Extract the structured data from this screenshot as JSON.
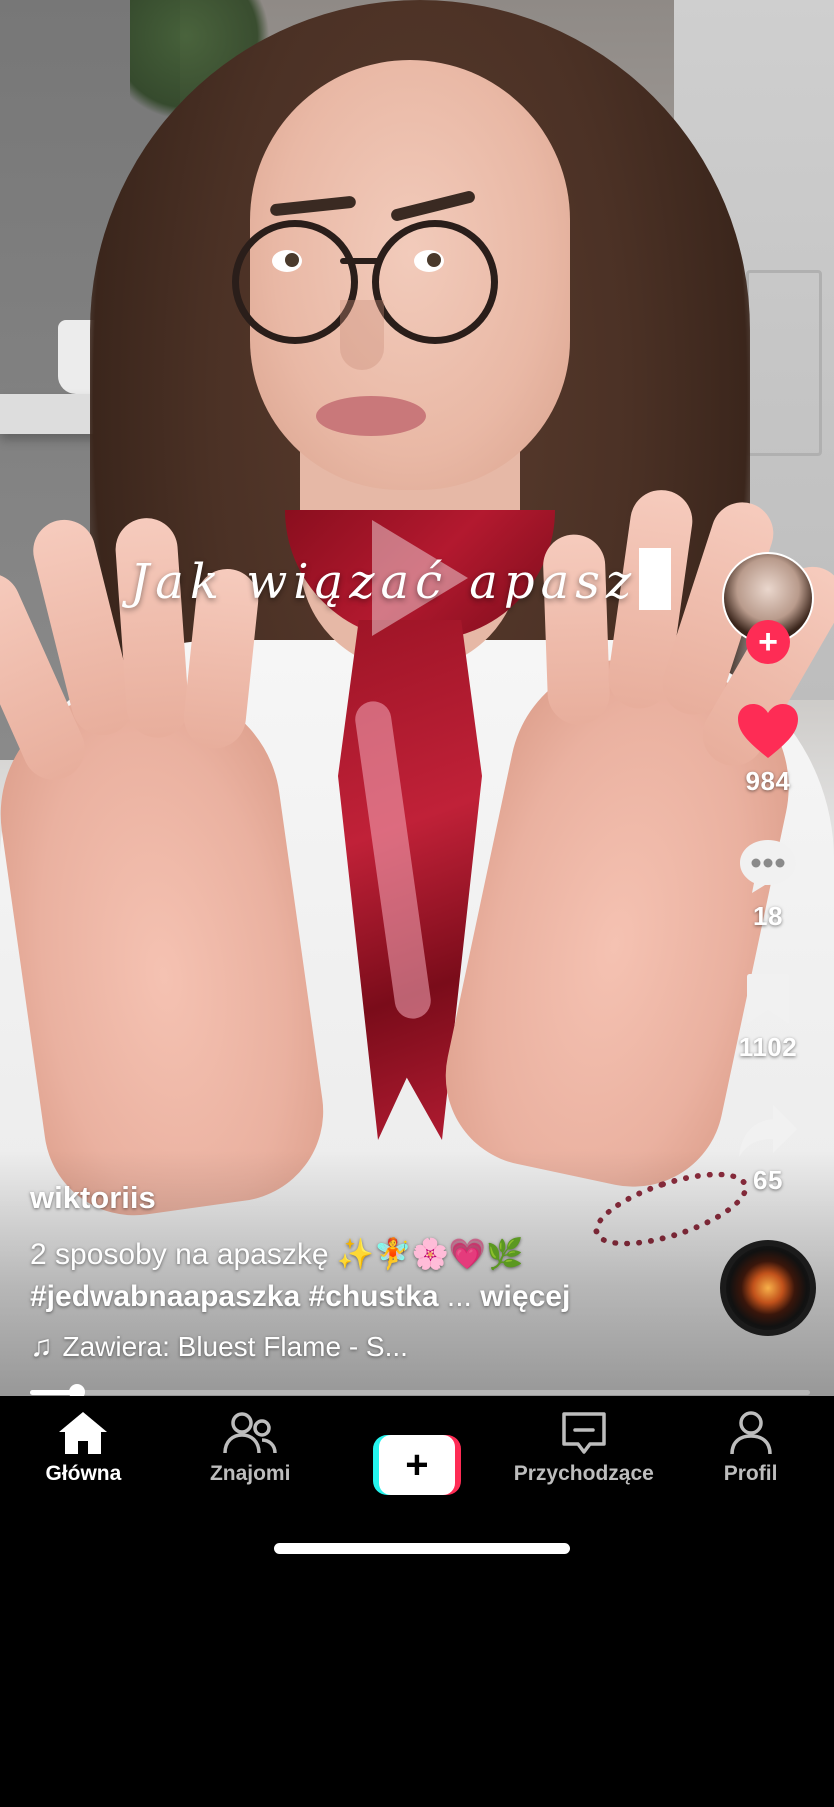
{
  "video": {
    "overlay_text": "Jak wiązać apasz"
  },
  "author": {
    "username": "wiktoriis"
  },
  "caption": {
    "text": "2 sposoby na apaszkę ✨🧚🌸💗🌿",
    "hashtags": "#jedwabnaapaszka #chustka",
    "ellipsis": " ... ",
    "more_label": "więcej"
  },
  "sound": {
    "icon": "music-note-icon",
    "label": "Zawiera: Bluest Flame - S..."
  },
  "actions": {
    "likes": "984",
    "comments": "18",
    "saves": "1102",
    "shares": "65"
  },
  "follow_symbol": "+",
  "progress": 0.06,
  "tabbar": {
    "home": "Główna",
    "friends": "Znajomi",
    "create_symbol": "+",
    "inbox": "Przychodzące",
    "profile": "Profil"
  },
  "colors": {
    "like_red": "#fe2c55",
    "create_cyan": "#25f4ee",
    "create_red": "#fe2c55"
  }
}
